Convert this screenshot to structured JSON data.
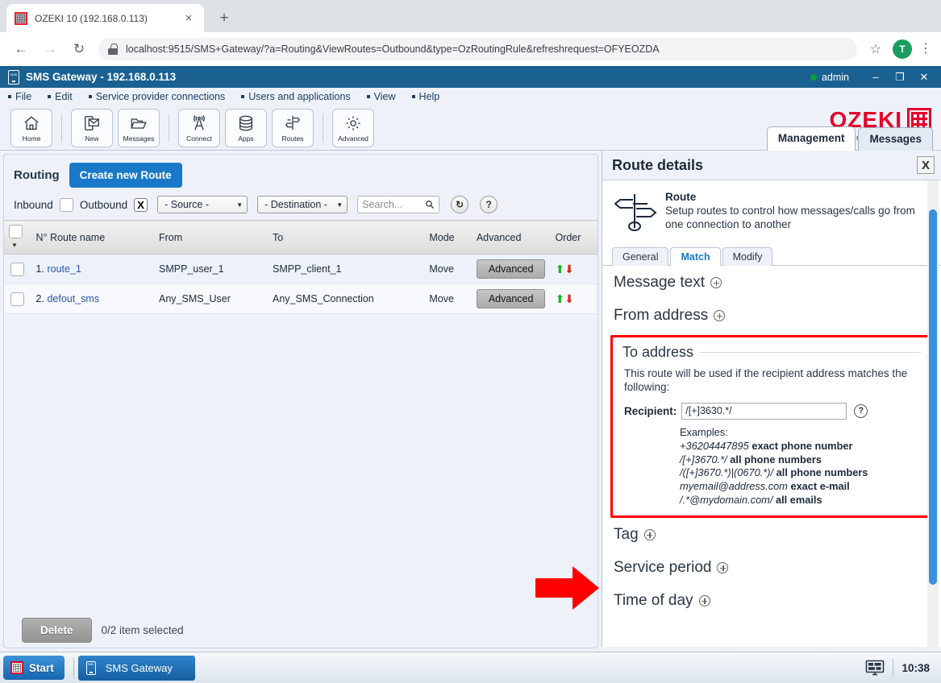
{
  "browser": {
    "tab_title": "OZEKI 10 (192.168.0.113)",
    "tab_close": "×",
    "new_tab": "+",
    "back": "←",
    "forward": "→",
    "reload": "↻",
    "url": "localhost:9515/SMS+Gateway/?a=Routing&ViewRoutes=Outbound&type=OzRoutingRule&refreshrequest=OFYEOZDA",
    "bookmark": "☆",
    "profile_initial": "T",
    "menu": "⋮"
  },
  "app": {
    "title": "SMS Gateway",
    "title_ip": "- 192.168.0.113",
    "user": "admin",
    "minimize": "–",
    "maximize": "❐",
    "close": "✕",
    "menubar": [
      {
        "label": "File"
      },
      {
        "label": "Edit"
      },
      {
        "label": "Service provider connections"
      },
      {
        "label": "Users and applications"
      },
      {
        "label": "View"
      },
      {
        "label": "Help"
      }
    ],
    "toolbar_groups": [
      {
        "buttons": [
          {
            "label": "Home",
            "icon": "home-icon"
          }
        ]
      },
      {
        "buttons": [
          {
            "label": "New",
            "icon": "new-message-icon"
          },
          {
            "label": "Messages",
            "icon": "folder-icon"
          }
        ]
      },
      {
        "buttons": [
          {
            "label": "Connect",
            "icon": "antenna-icon"
          },
          {
            "label": "Apps",
            "icon": "database-icon"
          },
          {
            "label": "Routes",
            "icon": "signpost-icon"
          }
        ]
      },
      {
        "buttons": [
          {
            "label": "Advanced",
            "icon": "gear-icon"
          }
        ]
      }
    ],
    "brand": {
      "name": "OZEKI",
      "url_plain_1": "www.my",
      "url_accent": "ozeki",
      "url_plain_2": ".com",
      "color": "#e4002b"
    },
    "top_tabs": [
      {
        "label": "Management",
        "active": true
      },
      {
        "label": "Messages",
        "active": false
      }
    ]
  },
  "left_pane": {
    "title": "Routing",
    "create_button": "Create new Route",
    "filters": {
      "inbound_label": "Inbound",
      "inbound_checked": false,
      "outbound_label": "Outbound",
      "outbound_mark": "X",
      "source_select": "- Source -",
      "destination_select": "- Destination -",
      "search_placeholder": "Search...",
      "search_value": "",
      "refresh_icon": "↻",
      "help_icon": "?"
    },
    "table": {
      "headers": [
        "",
        "N° Route name",
        "From",
        "To",
        "Mode",
        "Advanced",
        "Order"
      ],
      "rows": [
        {
          "num": "1.",
          "name": "route_1",
          "from": "SMPP_user_1",
          "to": "SMPP_client_1",
          "mode": "Move",
          "advanced": "Advanced",
          "up": "⬆",
          "down": "⬇"
        },
        {
          "num": "2.",
          "name": "defout_sms",
          "from": "Any_SMS_User",
          "to": "Any_SMS_Connection",
          "mode": "Move",
          "advanced": "Advanced",
          "up": "⬆",
          "down": "⬇"
        }
      ]
    },
    "footer": {
      "delete_button": "Delete",
      "selection": "0/2 item selected"
    }
  },
  "right_pane": {
    "title": "Route details",
    "close": "X",
    "intro_title": "Route",
    "intro_text": "Setup routes to control how messages/calls go from one connection to another",
    "subtabs": [
      {
        "label": "General",
        "active": false
      },
      {
        "label": "Match",
        "active": true
      },
      {
        "label": "Modify",
        "active": false
      }
    ],
    "sections_before": [
      {
        "label": "Message text"
      },
      {
        "label": "From address"
      }
    ],
    "to_address": {
      "legend": "To address",
      "description": "This route will be used if the recipient address matches the following:",
      "recipient_label": "Recipient:",
      "recipient_value": "/[+]3630.*/",
      "help_icon": "?",
      "examples_title": "Examples:",
      "examples": [
        {
          "pattern": "+36204447895",
          "desc": "exact phone number"
        },
        {
          "pattern": "/[+]3670.*/",
          "desc": "all phone numbers"
        },
        {
          "pattern": "/([+]3670.*)|(0670.*)/",
          "desc": "all phone numbers"
        },
        {
          "pattern": "myemail@address.com",
          "desc": "exact e-mail"
        },
        {
          "pattern": "/.*@mydomain.com/",
          "desc": "all emails"
        }
      ]
    },
    "sections_after": [
      {
        "label": "Tag"
      },
      {
        "label": "Service period"
      },
      {
        "label": "Time of day"
      }
    ],
    "highlight_color": "#ff0000"
  },
  "taskbar": {
    "start_label": "Start",
    "task_label": "SMS Gateway",
    "tray_icon": "monitor-icon",
    "clock": "10:38"
  }
}
